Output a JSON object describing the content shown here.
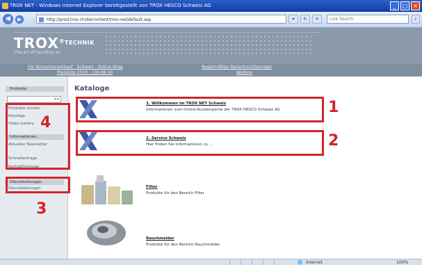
{
  "window": {
    "title": "TROX NET - Windows Internet Explorer bereitgestellt von TROX HESCO Schweiz AG"
  },
  "toolbar": {
    "address": "http://prod.trox.ch/de/content/trox-net/default.asp",
    "go_label": "",
    "search_placeholder": "Live Search"
  },
  "brand": {
    "logo": "TROX",
    "logo_sup": "®",
    "logo_sub": "TECHNIK",
    "tagline": "The art of handling air"
  },
  "menu": {
    "left_line1": "Für Konsumeneinkauf · Schweiz · Online Shop",
    "left_line2": "Preisliste 2010 · 139.68.00",
    "right_line1": "Regelmäßige Benachrichtigungen",
    "right_line2": "Weitere"
  },
  "sidebar": {
    "section1": "Produkte",
    "search_value": "»»",
    "items1": [
      "Produkte suchen",
      "Kataloge",
      "Video Gallery"
    ],
    "section2": "Informationen",
    "items2": [
      "Aktueller Newsletter",
      "Schnellanfrage",
      "Kontaktformular"
    ],
    "section3": "Dienstleistungen",
    "items3": [
      "Dienstleistungen"
    ]
  },
  "main": {
    "title": "Kataloge",
    "entries": [
      {
        "title": "1. Willkommen im TROX NET Schweiz",
        "desc": "Informationen zum Online-Kundenportal der TROX HESCO Schweiz AG"
      },
      {
        "title": "2. Service Schweiz",
        "desc": "Hier finden Sie Informationen zu ..."
      },
      {
        "title": "Filter",
        "desc": "Produkte für den Bereich Filter"
      },
      {
        "title": "Rauchmelder",
        "desc": "Produkte für den Bereich Rauchmelder"
      }
    ]
  },
  "annotations": {
    "n1": "1",
    "n2": "2",
    "n3": "3",
    "n4": "4",
    "color": "#d2252b"
  },
  "status": {
    "zone": "Internet",
    "zoom": "100%"
  }
}
